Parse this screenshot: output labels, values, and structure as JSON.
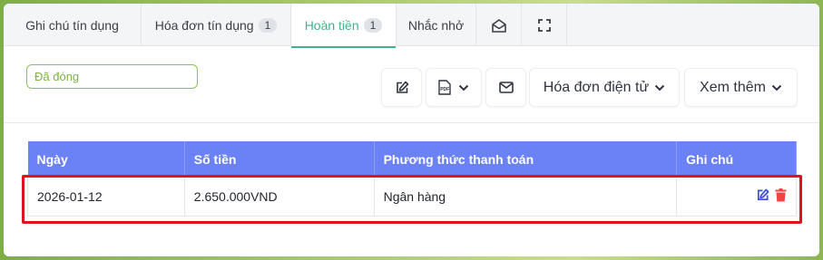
{
  "tabs": [
    {
      "label": "Ghi chú tín dụng",
      "count": null
    },
    {
      "label": "Hóa đơn tín dụng",
      "count": "1"
    },
    {
      "label": "Hoàn tiền",
      "count": "1",
      "active": true
    },
    {
      "label": "Nhắc nhở",
      "count": null
    }
  ],
  "status": "Đã đóng",
  "toolbar": {
    "einvoice_label": "Hóa đơn điện tử",
    "more_label": "Xem thêm"
  },
  "table": {
    "headers": [
      "Ngày",
      "Số tiền",
      "Phương thức thanh toán",
      "Ghi chú"
    ],
    "rows": [
      {
        "date": "2026-01-12",
        "amount": "2.650.000VND",
        "method": "Ngân hàng",
        "note": ""
      }
    ]
  },
  "colors": {
    "accent": "#3eb489",
    "header_bg": "#6b82f7",
    "status": "#7cb342",
    "delete": "#ef4444",
    "edit": "#3b4bd8",
    "highlight": "#e0141e"
  },
  "icons": {
    "edit_toolbar": "edit-icon",
    "pdf": "pdf-icon",
    "mail": "mail-icon",
    "envelope_tab": "envelope-open-icon",
    "fullscreen": "fullscreen-icon",
    "row_edit": "edit-icon",
    "row_delete": "trash-icon"
  }
}
